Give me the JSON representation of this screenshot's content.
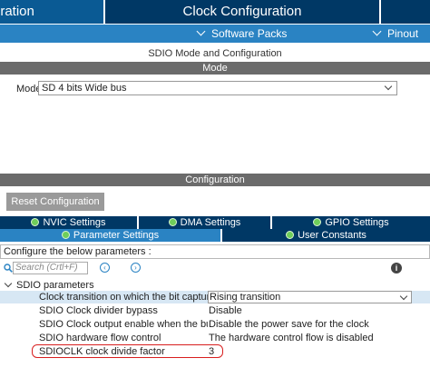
{
  "tabs": {
    "left_label": "uration",
    "clock_label": "Clock Configuration"
  },
  "subbar": {
    "software_packs": "Software Packs",
    "pinout": "Pinout"
  },
  "panel_title": "SDIO Mode and Configuration",
  "mode_section": {
    "header": "Mode",
    "mode_label": "Mode",
    "mode_value": "SD 4 bits Wide bus"
  },
  "config_section": {
    "header": "Configuration",
    "reset_button": "Reset Configuration",
    "tabs_row1": [
      "NVIC Settings",
      "DMA Settings",
      "GPIO Settings"
    ],
    "tabs_row2": [
      "Parameter Settings",
      "User Constants"
    ],
    "configure_text": "Configure the below parameters :",
    "search_placeholder": "Search (Crtl+F)",
    "group_label": "SDIO parameters",
    "parameters": [
      {
        "name": "Clock transition on which the bit capture is ...",
        "value": "Rising transition"
      },
      {
        "name": "SDIO Clock divider bypass",
        "value": "Disable"
      },
      {
        "name": "SDIO Clock output enable when the bus is i...",
        "value": "Disable the power save for the clock"
      },
      {
        "name": "SDIO hardware flow control",
        "value": "The hardware control flow is disabled"
      },
      {
        "name": "SDIOCLK clock divide factor",
        "value": "3"
      }
    ]
  },
  "colors": {
    "dark_navy": "#003865",
    "accent_blue": "#2a83c3",
    "section_grey": "#6b6b6b",
    "highlight_red": "#d81e1e",
    "check_green": "#6fce5a"
  },
  "icons": [
    "chevron-down-icon",
    "check-circle-icon",
    "search-icon",
    "arrow-left-circle-icon",
    "arrow-right-circle-icon",
    "info-icon"
  ]
}
